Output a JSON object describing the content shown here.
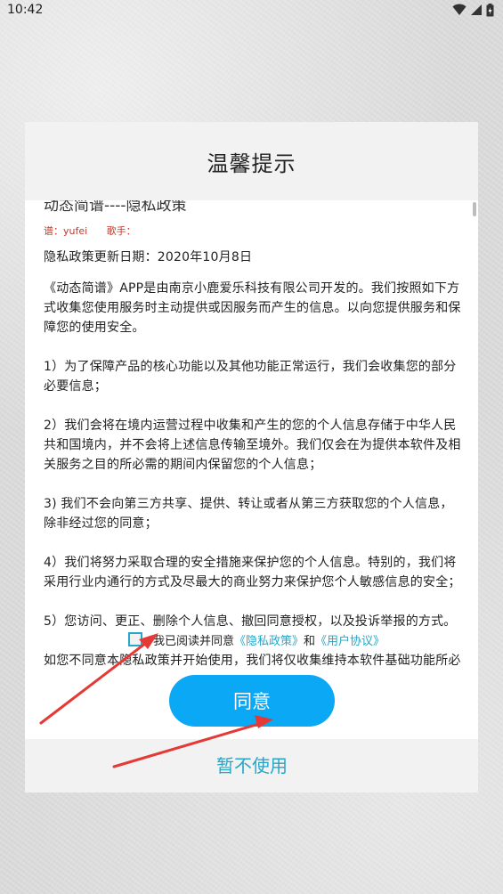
{
  "status_bar": {
    "time": "10:42"
  },
  "dialog": {
    "title": "温馨提示",
    "document": {
      "title": "动态简谱----隐私政策",
      "meta": {
        "score_by": "谱：yufei",
        "singer": "歌手："
      },
      "update_date": "隐私政策更新日期：2020年10月8日",
      "paragraphs": [
        "《动态简谱》APP是由南京小鹿爱乐科技有限公司开发的。我们按照如下方式收集您使用服务时主动提供或因服务而产生的信息。以向您提供服务和保障您的使用安全。",
        "1）为了保障产品的核心功能以及其他功能正常运行，我们会收集您的部分必要信息；",
        "2）我们会将在境内运营过程中收集和产生的您的个人信息存储于中华人民共和国境内，并不会将上述信息传输至境外。我们仅会在为提供本软件及相关服务之目的所必需的期间内保留您的个人信息；",
        "3) 我们不会向第三方共享、提供、转让或者从第三方获取您的个人信息，除非经过您的同意；",
        "4）我们将努力采取合理的安全措施来保护您的个人信息。特别的，我们将采用行业内通行的方式及尽最大的商业努力来保护您个人敏感信息的安全；",
        "5）您访问、更正、删除个人信息、撤回同意授权，以及投诉举报的方式。",
        "如您不同意本隐私政策并开始使用，我们将仅收集维持本软件基础功能所必"
      ]
    },
    "consent": {
      "prefix": "我已阅读并同意",
      "privacy_link": "《隐私政策》",
      "and": "和",
      "user_agreement_link": "《用户协议》",
      "checked": false
    },
    "agree_button": "同意",
    "decline_button": "暂不使用"
  },
  "colors": {
    "accent": "#0aa8f5",
    "link": "#26a6c8",
    "meta_red": "#c0392b",
    "arrow": "#e53935"
  }
}
